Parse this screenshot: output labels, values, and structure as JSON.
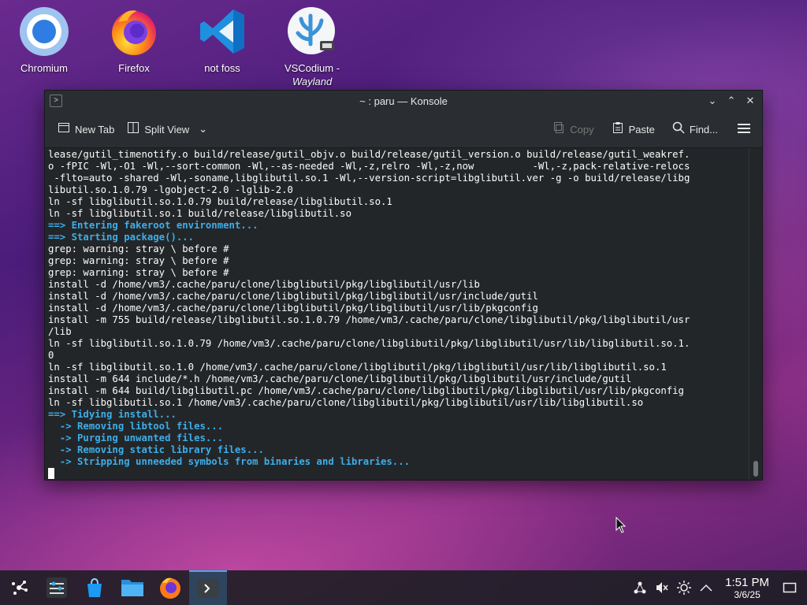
{
  "desktop": {
    "icons": [
      {
        "label": "Chromium",
        "label2": ""
      },
      {
        "label": "Firefox",
        "label2": ""
      },
      {
        "label": "not foss",
        "label2": ""
      },
      {
        "label": "VSCodium -",
        "label2": "Wayland"
      }
    ]
  },
  "window": {
    "title": "~ : paru — Konsole",
    "toolbar": {
      "new_tab": "New Tab",
      "split_view": "Split View",
      "copy": "Copy",
      "paste": "Paste",
      "find": "Find..."
    },
    "terminal_lines": [
      {
        "text": "lease/gutil_timenotify.o build/release/gutil_objv.o build/release/gutil_version.o build/release/gutil_weakref.",
        "style": "normal"
      },
      {
        "text": "o -fPIC -Wl,-O1 -Wl,--sort-common -Wl,--as-needed -Wl,-z,relro -Wl,-z,now          -Wl,-z,pack-relative-relocs",
        "style": "normal"
      },
      {
        "text": " -flto=auto -shared -Wl,-soname,libglibutil.so.1 -Wl,--version-script=libglibutil.ver -g -o build/release/libg",
        "style": "normal"
      },
      {
        "text": "libutil.so.1.0.79 -lgobject-2.0 -lglib-2.0",
        "style": "normal"
      },
      {
        "text": "ln -sf libglibutil.so.1.0.79 build/release/libglibutil.so.1",
        "style": "normal"
      },
      {
        "text": "ln -sf libglibutil.so.1 build/release/libglibutil.so",
        "style": "normal"
      },
      {
        "text": "==> Entering fakeroot environment...",
        "style": "blue"
      },
      {
        "text": "==> Starting package()...",
        "style": "blue"
      },
      {
        "text": "grep: warning: stray \\ before #",
        "style": "normal"
      },
      {
        "text": "grep: warning: stray \\ before #",
        "style": "normal"
      },
      {
        "text": "grep: warning: stray \\ before #",
        "style": "normal"
      },
      {
        "text": "install -d /home/vm3/.cache/paru/clone/libglibutil/pkg/libglibutil/usr/lib",
        "style": "normal"
      },
      {
        "text": "install -d /home/vm3/.cache/paru/clone/libglibutil/pkg/libglibutil/usr/include/gutil",
        "style": "normal"
      },
      {
        "text": "install -d /home/vm3/.cache/paru/clone/libglibutil/pkg/libglibutil/usr/lib/pkgconfig",
        "style": "normal"
      },
      {
        "text": "install -m 755 build/release/libglibutil.so.1.0.79 /home/vm3/.cache/paru/clone/libglibutil/pkg/libglibutil/usr",
        "style": "normal"
      },
      {
        "text": "/lib",
        "style": "normal"
      },
      {
        "text": "ln -sf libglibutil.so.1.0.79 /home/vm3/.cache/paru/clone/libglibutil/pkg/libglibutil/usr/lib/libglibutil.so.1.",
        "style": "normal"
      },
      {
        "text": "0",
        "style": "normal"
      },
      {
        "text": "ln -sf libglibutil.so.1.0 /home/vm3/.cache/paru/clone/libglibutil/pkg/libglibutil/usr/lib/libglibutil.so.1",
        "style": "normal"
      },
      {
        "text": "install -m 644 include/*.h /home/vm3/.cache/paru/clone/libglibutil/pkg/libglibutil/usr/include/gutil",
        "style": "normal"
      },
      {
        "text": "install -m 644 build/libglibutil.pc /home/vm3/.cache/paru/clone/libglibutil/pkg/libglibutil/usr/lib/pkgconfig",
        "style": "normal"
      },
      {
        "text": "ln -sf libglibutil.so.1 /home/vm3/.cache/paru/clone/libglibutil/pkg/libglibutil/usr/lib/libglibutil.so",
        "style": "normal"
      },
      {
        "text": "==> Tidying install...",
        "style": "blue"
      },
      {
        "text": "  -> Removing libtool files...",
        "style": "blue"
      },
      {
        "text": "  -> Purging unwanted files...",
        "style": "blue"
      },
      {
        "text": "  -> Removing static library files...",
        "style": "blue"
      },
      {
        "text": "  -> Stripping unneeded symbols from binaries and libraries...",
        "style": "blue"
      },
      {
        "text": "",
        "style": "normal"
      }
    ]
  },
  "taskbar": {
    "clock_time": "1:51 PM",
    "clock_date": "3/6/25"
  }
}
